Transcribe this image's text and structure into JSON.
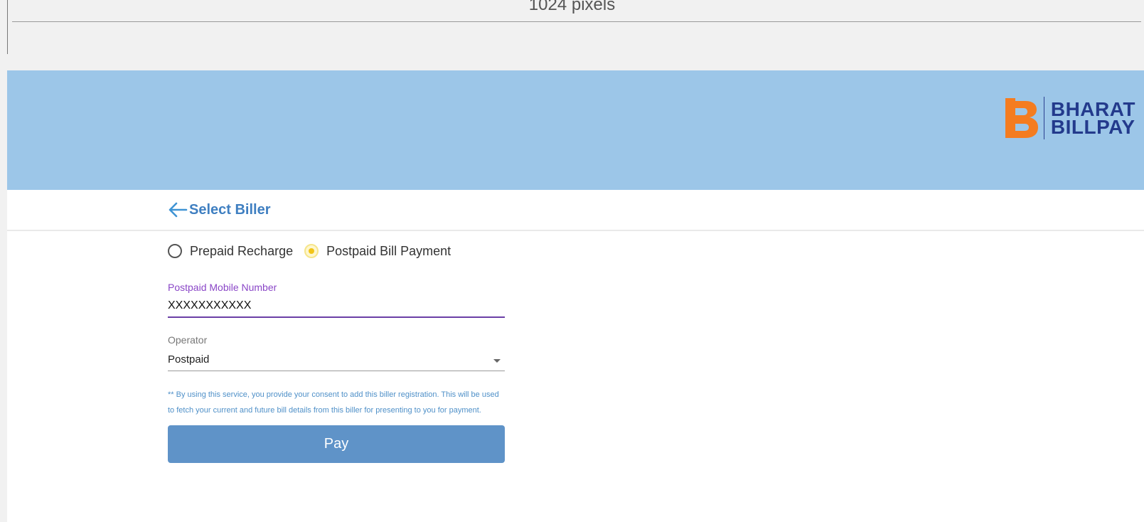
{
  "dimension_caption": "1024 pixels",
  "brand": {
    "line1": "BHARAT",
    "line2": "BILLPAY",
    "colors": {
      "mark": "#f47c20",
      "text": "#233a8c"
    }
  },
  "header": {
    "title": "Select Biller",
    "back_icon": "arrow-left-icon"
  },
  "payment_type": {
    "options": [
      {
        "label": "Prepaid Recharge",
        "selected": false
      },
      {
        "label": "Postpaid Bill Payment",
        "selected": true
      }
    ]
  },
  "fields": {
    "mobile": {
      "label": "Postpaid Mobile Number",
      "value": "XXXXXXXXXXX"
    },
    "operator": {
      "label": "Operator",
      "value": "Postpaid",
      "icon": "chevron-down-icon"
    }
  },
  "consent_text": "** By using this service, you provide your consent to add this biller registration. This will be used to fetch your current and future bill details from this biller for presenting to you for payment.",
  "pay_button": {
    "label": "Pay"
  },
  "colors": {
    "header_bg": "#9cc6e8",
    "accent": "#3f7fc1",
    "button": "#5f93c8",
    "label_active": "#8a46c7",
    "radio_selected": "#f2c418"
  }
}
